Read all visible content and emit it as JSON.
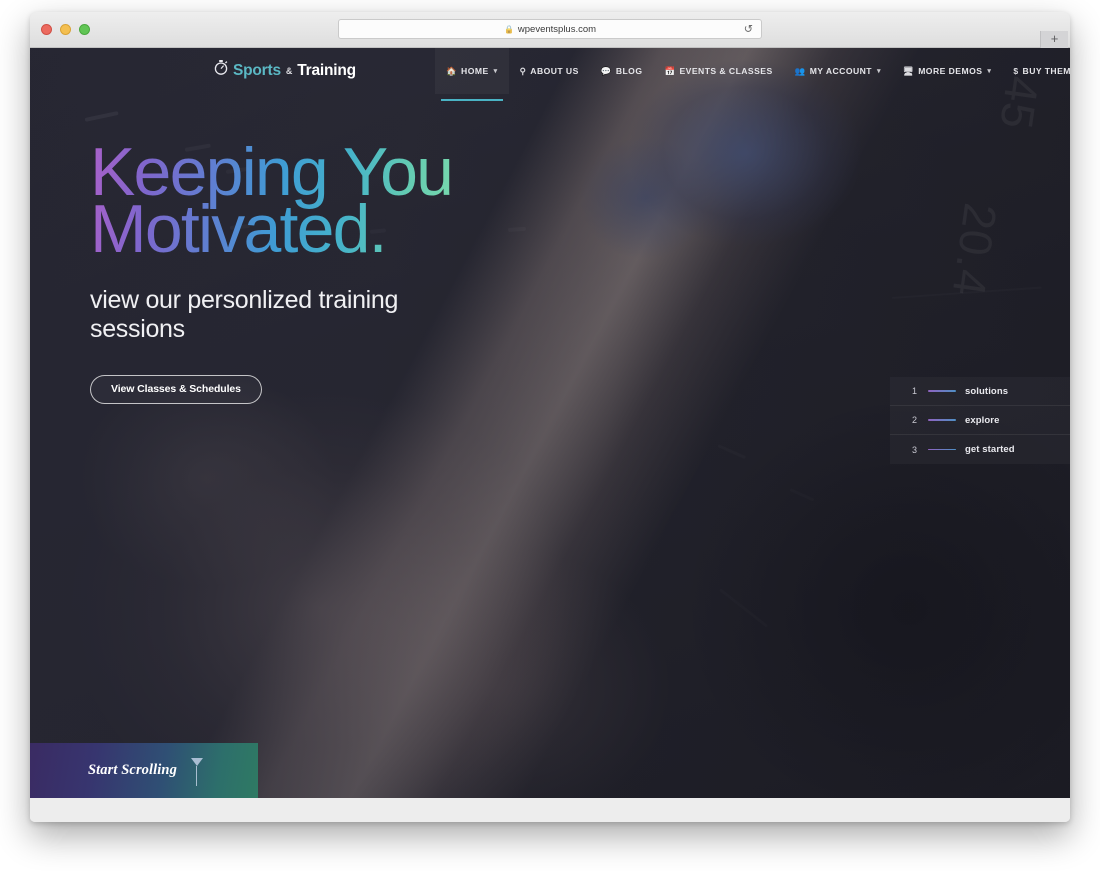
{
  "browser": {
    "url": "wpeventsplus.com",
    "lock_icon": "lock-icon",
    "reload_icon": "reload-icon",
    "newtab_label": "+",
    "traffic_lights": [
      "close",
      "minimize",
      "maximize"
    ]
  },
  "site": {
    "logo": {
      "icon": "stopwatch-icon",
      "primary": "Sports",
      "amp": "&",
      "secondary": "Training"
    },
    "nav": [
      {
        "icon": "home-icon",
        "label": "HOME",
        "caret": "▾",
        "active": true
      },
      {
        "icon": "pin-icon",
        "label": "ABOUT US",
        "caret": "",
        "active": false
      },
      {
        "icon": "comment-icon",
        "label": "BLOG",
        "caret": "",
        "active": false
      },
      {
        "icon": "calendar-icon",
        "label": "EVENTS & CLASSES",
        "caret": "",
        "active": false
      },
      {
        "icon": "users-icon",
        "label": "MY ACCOUNT",
        "caret": "▾",
        "active": false
      },
      {
        "icon": "desktop-icon",
        "label": "MORE DEMOS",
        "caret": "▾",
        "active": false
      },
      {
        "icon": "dollar-icon",
        "label": "BUY THEME",
        "caret": "",
        "active": false
      }
    ]
  },
  "hero": {
    "title_line1": "Keeping You",
    "title_line2": "Motivated.",
    "subtitle": "view our personlized training sessions",
    "cta_label": "View Classes & Schedules",
    "gradient_start": "#a961c9",
    "gradient_end": "#79d9ac",
    "background_numbers": [
      "45",
      "20.4"
    ]
  },
  "slide_nav": [
    {
      "number": "1",
      "label": "solutions"
    },
    {
      "number": "2",
      "label": "explore"
    },
    {
      "number": "3",
      "label": "get started"
    }
  ],
  "scroll_cue": {
    "label": "Start Scrolling",
    "arrow_icon": "arrow-down-icon"
  }
}
